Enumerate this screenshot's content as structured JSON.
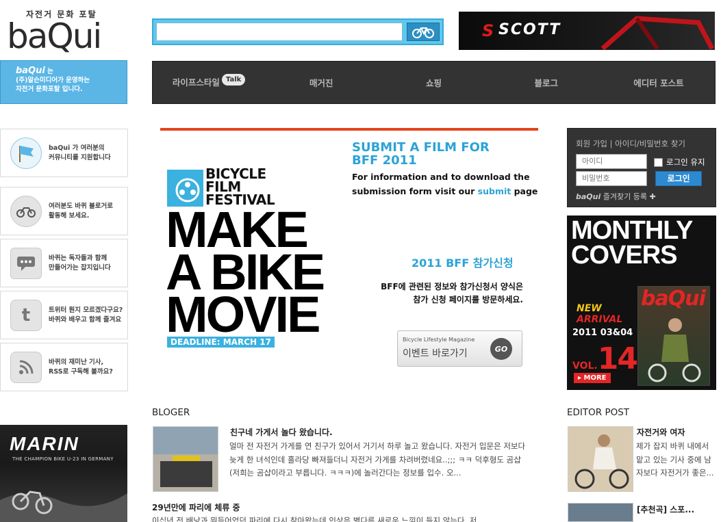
{
  "logo": {
    "tagline": "자전거 문화 포탈",
    "wordmark": "baQui"
  },
  "search": {
    "placeholder": "",
    "value": ""
  },
  "ads": {
    "scott": {
      "brand": "SCOTT"
    },
    "marin": {
      "brand": "MARIN",
      "slogan": "THE CHAMPION BIKE U-23 IN GERMANY"
    }
  },
  "intro": {
    "brand": "baQui",
    "line1": "는",
    "line2": "(주)알슨미디어가 운영하는",
    "line3": "자전거 문화포탈 입니다."
  },
  "nav": {
    "items": [
      {
        "label": "라이프스타일",
        "badge": "Talk"
      },
      {
        "label": "매거진"
      },
      {
        "label": "쇼핑"
      },
      {
        "label": "블로그"
      },
      {
        "label": "에디터 포스트"
      }
    ]
  },
  "promos": [
    {
      "icon": "flag-icon",
      "line1": "baQui 가 여러분의",
      "line2": "커뮤니티를 지원합니다"
    },
    {
      "icon": "bicycle-badge-icon",
      "line1": "여러분도 바퀴 블로거로",
      "line2": "활동해 보세요."
    },
    {
      "icon": "speech-bubble-icon",
      "line1": "바퀴는 독자들과 함께",
      "line2": "만들어가는 잡지입니다"
    },
    {
      "icon": "twitter-icon",
      "line1": "트위터 뭔지 모르겠다구요?",
      "line2": "바퀴와 배우고 함께 즐겨요"
    },
    {
      "icon": "rss-icon",
      "line1": "바퀴의 재미난 기사,",
      "line2": "RSS로 구독해 볼까요?"
    }
  ],
  "banner": {
    "festival_name": [
      "BICYCLE",
      "FILM",
      "FESTIVAL"
    ],
    "headline": [
      "MAKE",
      "A BIKE",
      "MOVIE"
    ],
    "deadline": "DEADLINE: MARCH 17",
    "submit_title": [
      "SUBMIT A FILM FOR",
      "BFF 2011"
    ],
    "submit_desc_line1": "For information and to download the",
    "submit_desc_pre": "submission form visit our ",
    "submit_desc_link": "submit",
    "submit_desc_post": " page",
    "apply_title": "2011 BFF 참가신청",
    "apply_desc": [
      "BFF에 관련된 정보와 참가신청서 양식은",
      "참가 신청 페이지를 방문하세요."
    ],
    "event_button": {
      "small": "Bicycle Lifestyle Magazine",
      "label": "이벤트 바로가기",
      "go": "GO"
    }
  },
  "login": {
    "links": "회원 가입 | 아이디/비밀번호 찾기",
    "id_placeholder": "아이디",
    "pw_placeholder": "비밀번호",
    "keep_login": "로그인 유지",
    "login_button": "로그인",
    "bookmark_brand": "baQui",
    "bookmark_label": "즐겨찾기 등록"
  },
  "covers": {
    "title": [
      "MONTHLY",
      "COVERS"
    ],
    "new": "NEW",
    "arrival": "ARRIVAL",
    "date": "2011 03&04",
    "vol_label": "VOL.",
    "vol_number": "14",
    "more": "MORE",
    "mag_title": "baQui"
  },
  "blogger": {
    "title": "BLOGER",
    "posts": [
      {
        "title": "친구네 가게서 놀다 왔습니다.",
        "excerpt": "얼마 전 자전거 가게를 연 친구가 있어서 거기서 하루 놀고 왔습니다. 자전거 입문은 저보다 늦게 한 녀석인데 홀라당 빠져들더니 자전거 가게를 차려버렸네요..;;; ㅋㅋ 덕후형도 곰샵(저희는 곰샵이라고 부릅니다. ㅋㅋㅋ)에 놀러간다는 정보를 입수. 오..."
      },
      {
        "title": "29년만에 파리에 체류 중",
        "excerpt": "이십년 전 배낭과 뭐듬어었던 파리에 다시 찾아왔는데 인상은 별다른 새로운 느낌이 들지 않는다. 저..."
      }
    ]
  },
  "editor": {
    "title": "EDITOR POST",
    "posts": [
      {
        "title": "자전거와 여자",
        "excerpt": "제가 잡지 바퀴 내에서 맡고 있는 기사 중에 남자보다 자전거가 좋은..."
      },
      {
        "title": "[추천곡] 스포..."
      }
    ]
  }
}
